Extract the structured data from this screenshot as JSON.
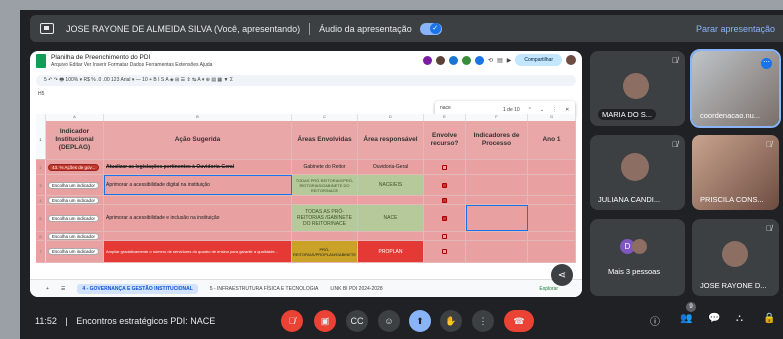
{
  "banner": {
    "presenter": "JOSE RAYONE DE ALMEIDA SILVA (Você, apresentando)",
    "audio_label": "Áudio da apresentação",
    "stop_label": "Parar apresentação"
  },
  "sheet": {
    "title": "Planilha de Preenchimento do PDI",
    "menu": "Arquivo  Editar  Ver  Inserir  Formatar  Dados  Ferramentas  Extensões  Ajuda",
    "share_label": "Compartilhar",
    "toolbar": "5  ↶  ↷  🖶  100%  ▾  R$  %  .0  .00  123  Arial  ▾  —  10  +  B  I  S  A  ◈  ⊞  ☰  ⇕  ↹  A  ▾  ⊕  ▤  ▦  ▼  Σ",
    "cell_ref": "H5",
    "find": {
      "query": "nace",
      "count": "1 de 10"
    },
    "col_letters": [
      "A",
      "B",
      "C",
      "D",
      "E",
      "F",
      "G"
    ],
    "headers": {
      "indicador": "Indicador Institucional (DEPLAG)",
      "acao": "Ação Sugerida",
      "areas": "Áreas Envolvidas",
      "resp": "Área responsável",
      "recurso": "Envolve recurso?",
      "processo": "Indicadores de Processo",
      "ano": "Ano 1"
    },
    "rows": [
      {
        "num": "2",
        "chip": "43. % Ações de gov...",
        "acao": "Atualizar as legislações pertinentes à Ouvidoria-Geral",
        "areas": "Gabinete do Reitor",
        "resp": "Ouvidoria-Geral",
        "checked": false
      },
      {
        "num": "3",
        "chip": "Escolha um indicador",
        "acao": "Aprimorar a acessibilidade digital na instituição",
        "areas": "TODAS PRÓ-REITORIAS/PRÓ-REITORIAS/GABINETE DO REITOR/NACE",
        "resp": "NACE/EIS",
        "checked": true
      },
      {
        "num": "4",
        "chip": "Escolha um indicador",
        "acao": "",
        "areas": "",
        "resp": "",
        "checked": true
      },
      {
        "num": "5",
        "chip": "Escolha um indicador",
        "acao": "Aprimorar a acessibilidade e inclusão na instituição",
        "areas": "TODAS AS PRÓ-REITORIAS /GABINETE DO REITOR/NACE",
        "resp": "NACE",
        "checked": true
      },
      {
        "num": "6",
        "chip": "Escolha um indicador",
        "acao": "",
        "areas": "",
        "resp": "",
        "checked": false
      },
      {
        "num": "7",
        "chip": "Escolha um indicador",
        "acao": "Ampliar gradativamente o número de servidores do quadro de ensino para garantir a qualidade...",
        "areas": "PRÓ-REITORIAS/PROPLAN/GABINETE",
        "resp": "PROPLAN",
        "checked": false
      }
    ],
    "tabs": {
      "active": "4 - GOVERNANÇA E GESTÃO INSTITUCIONAL",
      "second": "5 - INFRAESTRUTURA FÍSICA E TECNOLOGIA",
      "third": "LINK BI PDI 2024-2028",
      "explore": "Explorar"
    }
  },
  "participants": [
    {
      "name": "MARIA DO S..."
    },
    {
      "name": "coordenacao.nu..."
    },
    {
      "name": "JULIANA CANDI..."
    },
    {
      "name": "PRISCILA CONS..."
    },
    {
      "name": "Mais 3 pessoas"
    },
    {
      "name": "JOSE RAYONE D..."
    }
  ],
  "meeting": {
    "time": "11:52",
    "separator": "|",
    "name": "Encontros estratégicos PDI: NACE",
    "participant_count": "9"
  },
  "colors": {
    "accent": "#8ab4f8",
    "end_call": "#ea4335",
    "sheet_row": "#e8a0a0"
  }
}
